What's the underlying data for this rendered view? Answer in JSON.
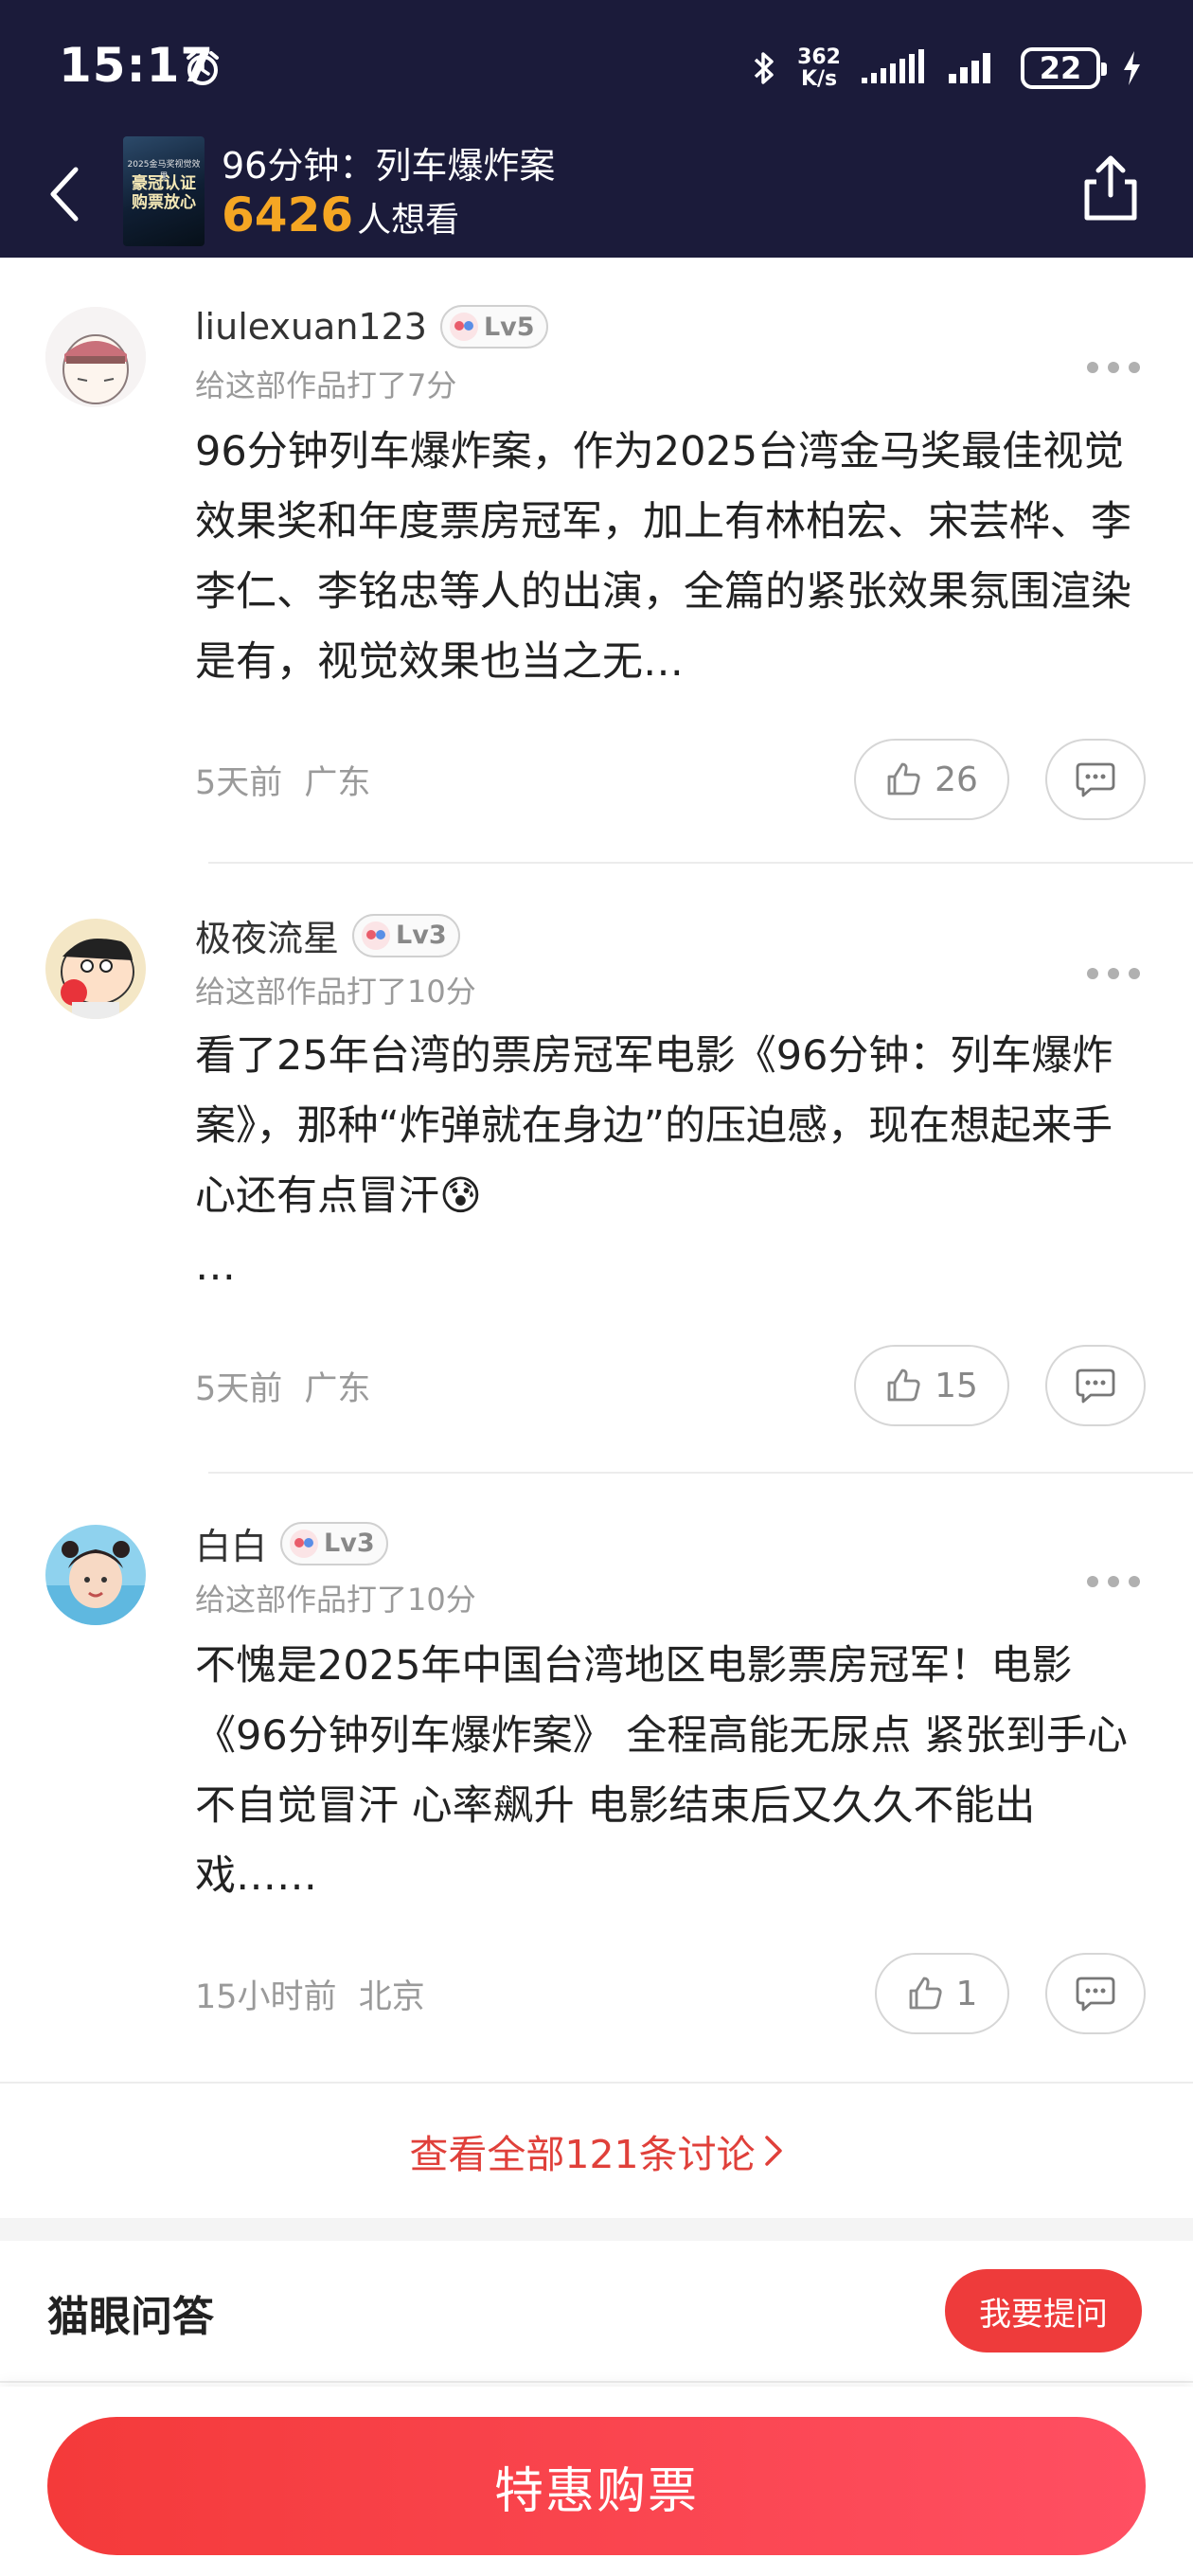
{
  "status_bar": {
    "time": "15:17",
    "net_speed_value": "362",
    "net_speed_unit": "K/s",
    "battery": "22"
  },
  "nav": {
    "movie_title": "96分钟：列车爆炸案",
    "want_count": "6426",
    "want_suffix": "人想看",
    "poster_line1": "豪冠认证",
    "poster_line2": "购票放心",
    "poster_small": "2025金马奖视觉效果"
  },
  "comments": [
    {
      "username": "liulexuan123",
      "level": "Lv5",
      "score": "给这部作品打了7分",
      "text": "96分钟列车爆炸案，作为2025台湾金马奖最佳视觉效果奖和年度票房冠军，加上有林柏宏、宋芸桦、李李仁、李铭忠等人的出演，全篇的紧张效果氛围渲染是有，视觉效果也当之无…",
      "time": "5天前",
      "location": "广东",
      "likes": "26"
    },
    {
      "username": "极夜流星",
      "level": "Lv3",
      "score": "给这部作品打了10分",
      "text": "看了25年台湾的票房冠军电影《96分钟：列车爆炸案》，那种“炸弹就在身边”的压迫感，现在想起来手心还有点冒汗😰",
      "ellipsis": "…",
      "time": "5天前",
      "location": "广东",
      "likes": "15"
    },
    {
      "username": "白白",
      "level": "Lv3",
      "score": "给这部作品打了10分",
      "text": "不愧是2025年中国台湾地区电影票房冠军！电影《96分钟列车爆炸案》 全程高能无尿点 紧张到手心不自觉冒汗 心率飙升 电影结束后又久久不能出戏……",
      "time": "15小时前",
      "location": "北京",
      "likes": "1"
    }
  ],
  "view_all": "查看全部121条讨论",
  "qa": {
    "title": "猫眼问答",
    "ask_button": "我要提问"
  },
  "buy_button": "特惠购票",
  "colors": {
    "header_bg": "#1b1b3a",
    "accent_red": "#ee3b3b",
    "want_orange": "#f5a623"
  },
  "icons": [
    "alarm-icon",
    "bluetooth-icon",
    "signal-icon",
    "charging-icon",
    "back-chevron-icon",
    "share-icon",
    "more-dots-icon",
    "thumbs-up-icon",
    "reply-bubble-icon",
    "chevron-right-icon"
  ]
}
